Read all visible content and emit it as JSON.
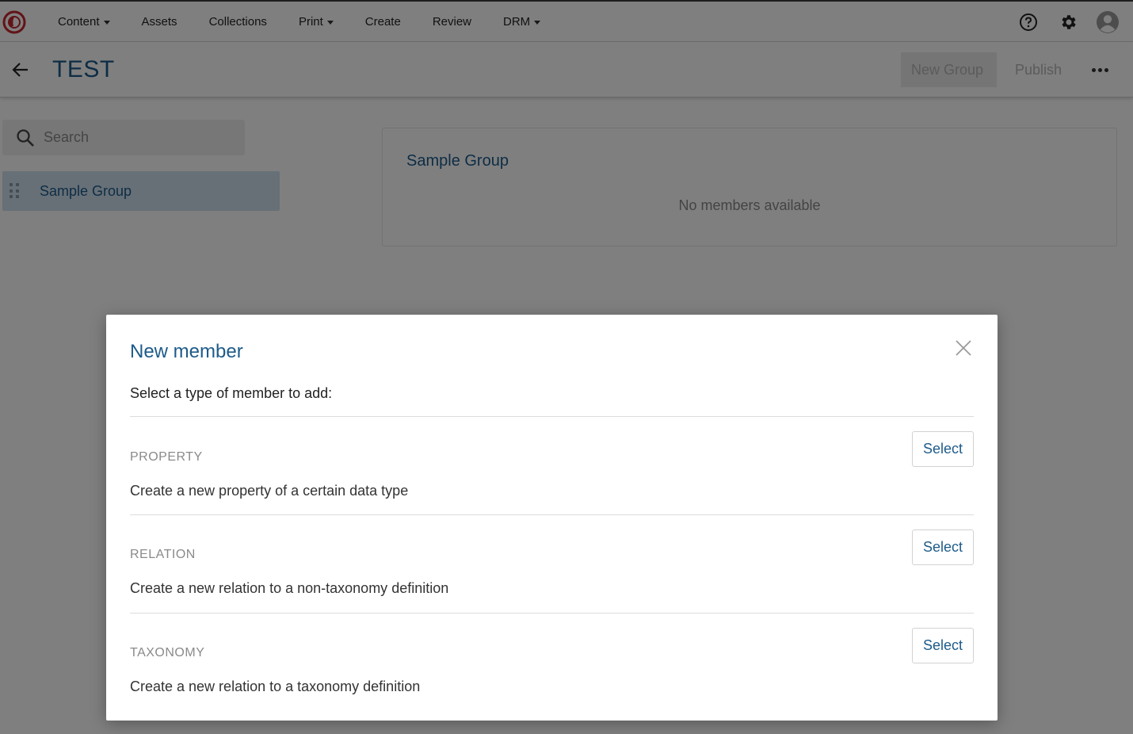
{
  "nav": {
    "items": [
      {
        "label": "Content",
        "dropdown": true
      },
      {
        "label": "Assets",
        "dropdown": false
      },
      {
        "label": "Collections",
        "dropdown": false
      },
      {
        "label": "Print",
        "dropdown": true
      },
      {
        "label": "Create",
        "dropdown": false
      },
      {
        "label": "Review",
        "dropdown": false
      },
      {
        "label": "DRM",
        "dropdown": true
      }
    ],
    "right_icons": [
      "help-icon",
      "gear-icon",
      "user-avatar-icon"
    ],
    "logo_color": "#c6262e"
  },
  "header": {
    "title": "TEST",
    "new_group_label": "New Group",
    "publish_label": "Publish"
  },
  "sidebar": {
    "search_placeholder": "Search",
    "groups": [
      {
        "label": "Sample Group"
      }
    ]
  },
  "main": {
    "group_title": "Sample Group",
    "empty_text": "No members available"
  },
  "modal": {
    "title": "New member",
    "subtitle": "Select a type of member to add:",
    "options": [
      {
        "type": "PROPERTY",
        "description": "Create a new property of a certain data type",
        "button": "Select"
      },
      {
        "type": "RELATION",
        "description": "Create a new relation to a non-taxonomy definition",
        "button": "Select"
      },
      {
        "type": "TAXONOMY",
        "description": "Create a new relation to a taxonomy definition",
        "button": "Select"
      }
    ]
  },
  "colors": {
    "accent": "#1d5b8a",
    "selected_bg": "#cfe0ee",
    "overlay": "rgba(0,0,0,0.5)"
  }
}
